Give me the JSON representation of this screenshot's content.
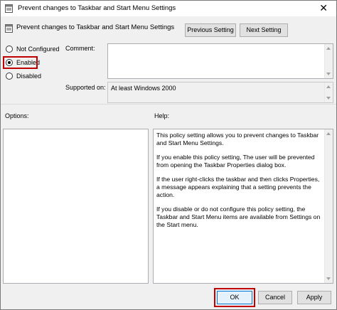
{
  "window": {
    "title": "Prevent changes to Taskbar and Start Menu Settings",
    "close_glyph": "✕"
  },
  "header": {
    "policy_name": "Prevent changes to Taskbar and Start Menu Settings",
    "previous_label": "Previous Setting",
    "next_label": "Next Setting"
  },
  "options": {
    "not_configured": "Not Configured",
    "enabled": "Enabled",
    "disabled": "Disabled",
    "selected": "enabled"
  },
  "comment": {
    "label": "Comment:",
    "value": ""
  },
  "supported": {
    "label": "Supported on:",
    "value": "At least Windows 2000"
  },
  "sections": {
    "options_label": "Options:",
    "help_label": "Help:"
  },
  "help": {
    "p1": "This policy setting allows you to prevent changes to Taskbar and Start Menu Settings.",
    "p2": "If you enable this policy setting, The user will be prevented from opening the Taskbar Properties dialog box.",
    "p3": "If the user right-clicks the taskbar and then clicks Properties, a message appears explaining that a setting prevents the action.",
    "p4": "If you disable or do not configure this policy setting, the Taskbar and Start Menu items are available from Settings on the Start menu."
  },
  "footer": {
    "ok_label": "OK",
    "cancel_label": "Cancel",
    "apply_label": "Apply"
  },
  "colors": {
    "highlight": "#c00000",
    "focus": "#0078d7"
  },
  "icons": {
    "title": "policy-settings-icon",
    "header": "policy-settings-icon",
    "close": "close-icon"
  }
}
